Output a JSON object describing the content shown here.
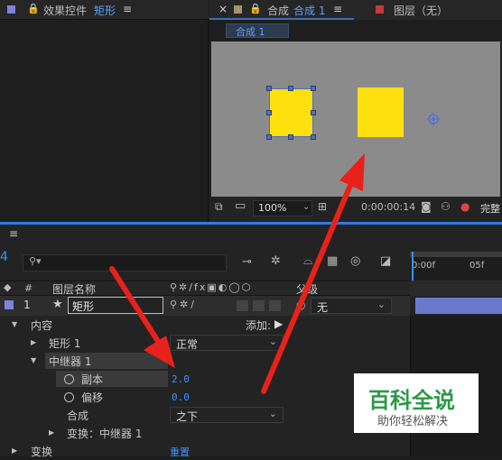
{
  "tabs": {
    "effects_panel": "效果控件",
    "effects_layer": "矩形",
    "comp_prefix": "合成",
    "comp_name": "合成 1",
    "layer_panel": "图层（无）",
    "menu": "≡"
  },
  "viewer": {
    "comp_tab": "合成 1",
    "zoom": "100%",
    "timecode": "0:00:00:14",
    "quality": "完整"
  },
  "timeline": {
    "menu": "≡",
    "time_partial": "4",
    "search_placeholder": "",
    "col_num": "#",
    "col_name": "图层名称",
    "col_parent": "父级",
    "layer": {
      "index": "1",
      "name": "矩形",
      "parent": "无"
    },
    "ruler": [
      "0:00f",
      "05f"
    ],
    "rows": {
      "content": "内容",
      "add_label": "添加:",
      "rect": "矩形 1",
      "blend_mode": "正常",
      "repeater": "中继器 1",
      "copies_label": "副本",
      "copies_value": "2.0",
      "offset_label": "偏移",
      "offset_value": "0.0",
      "composite_label": "合成",
      "composite_value": "之下",
      "transform_label": "变换：中继器 1",
      "transform_partial": "变换",
      "reset": "重置"
    }
  },
  "watermark": {
    "title": "百科全说",
    "subtitle": "助你轻松解决"
  },
  "colors": {
    "yellow": "#fde00d",
    "panel": "#232323",
    "viewer_bg": "#8b8b8b",
    "accent": "#3d8fff",
    "arrow": "#e8221a"
  }
}
